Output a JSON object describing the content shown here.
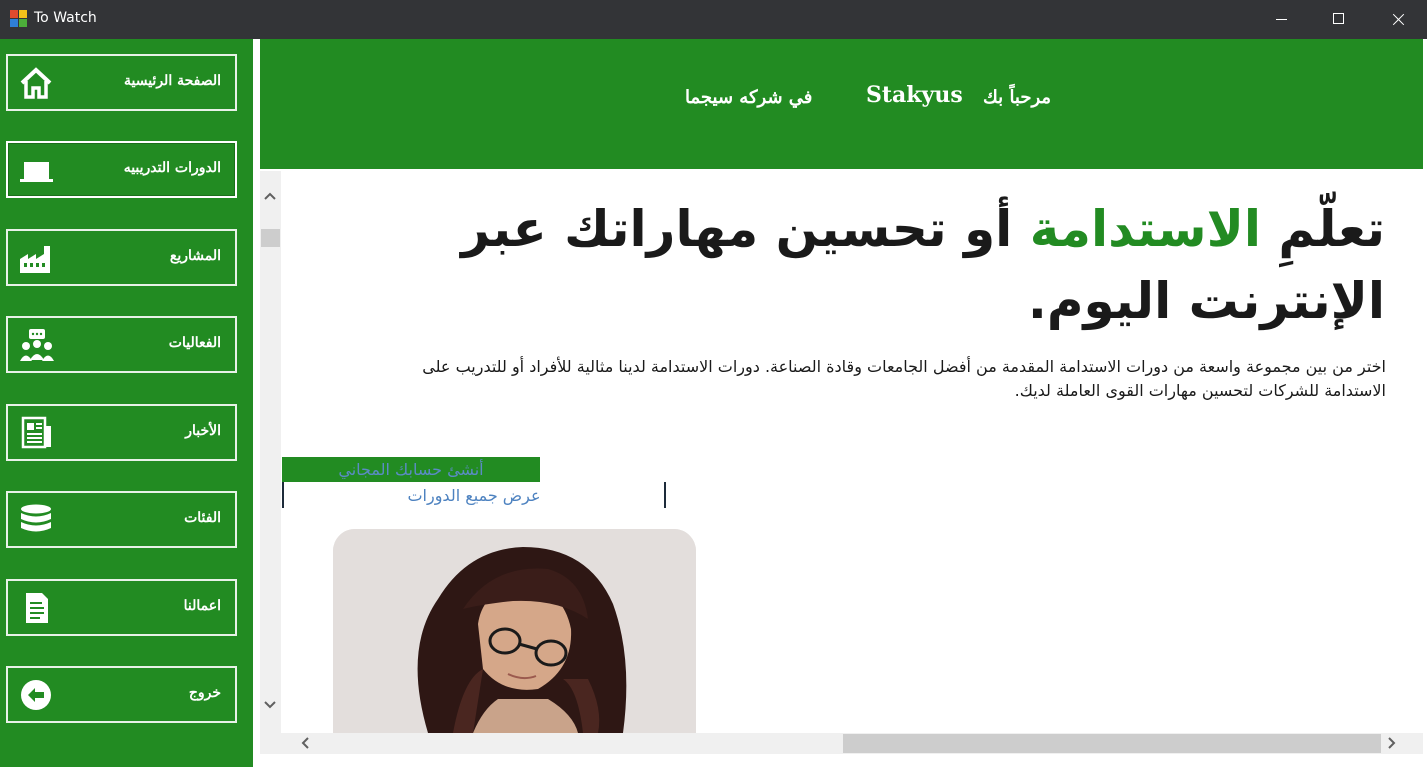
{
  "window": {
    "title": "To Watch"
  },
  "sidebar": {
    "items": [
      {
        "label": "الصفحة الرئيسية",
        "icon": "home-icon"
      },
      {
        "label": "الدورات التدريبيه",
        "icon": "laptop-icon",
        "active": true
      },
      {
        "label": "المشاريع",
        "icon": "factory-icon"
      },
      {
        "label": "الفعاليات",
        "icon": "audience-icon"
      },
      {
        "label": "الأخبار",
        "icon": "newspaper-icon"
      },
      {
        "label": "الفئات",
        "icon": "database-icon"
      },
      {
        "label": "اعمالنا",
        "icon": "document-icon"
      },
      {
        "label": "خروج",
        "icon": "exit-arrow-icon"
      }
    ]
  },
  "header": {
    "welcome": "مرحباً بك",
    "user": "Stakyus",
    "company": "في شركه سيجما"
  },
  "hero": {
    "part1": "تعلّمِ ",
    "accent": "الاستدامة",
    "part2": " أو تحسين مهاراتك عبر الإنترنت اليوم."
  },
  "description": "اختر من بين مجموعة واسعة من دورات الاستدامة المقدمة من أفضل الجامعات وقادة الصناعة. دورات الاستدامة لدينا مثالية للأفراد أو للتدريب على الاستدامة للشركات لتحسين مهارات القوى العاملة لديك.",
  "buttons": {
    "free_account": "أنشئ حسابك المجاني",
    "all_courses": "عرض جميع الدورات"
  },
  "colors": {
    "brand_green": "#228b22",
    "link_blue": "#4d82c0",
    "titlebar": "#333437"
  }
}
